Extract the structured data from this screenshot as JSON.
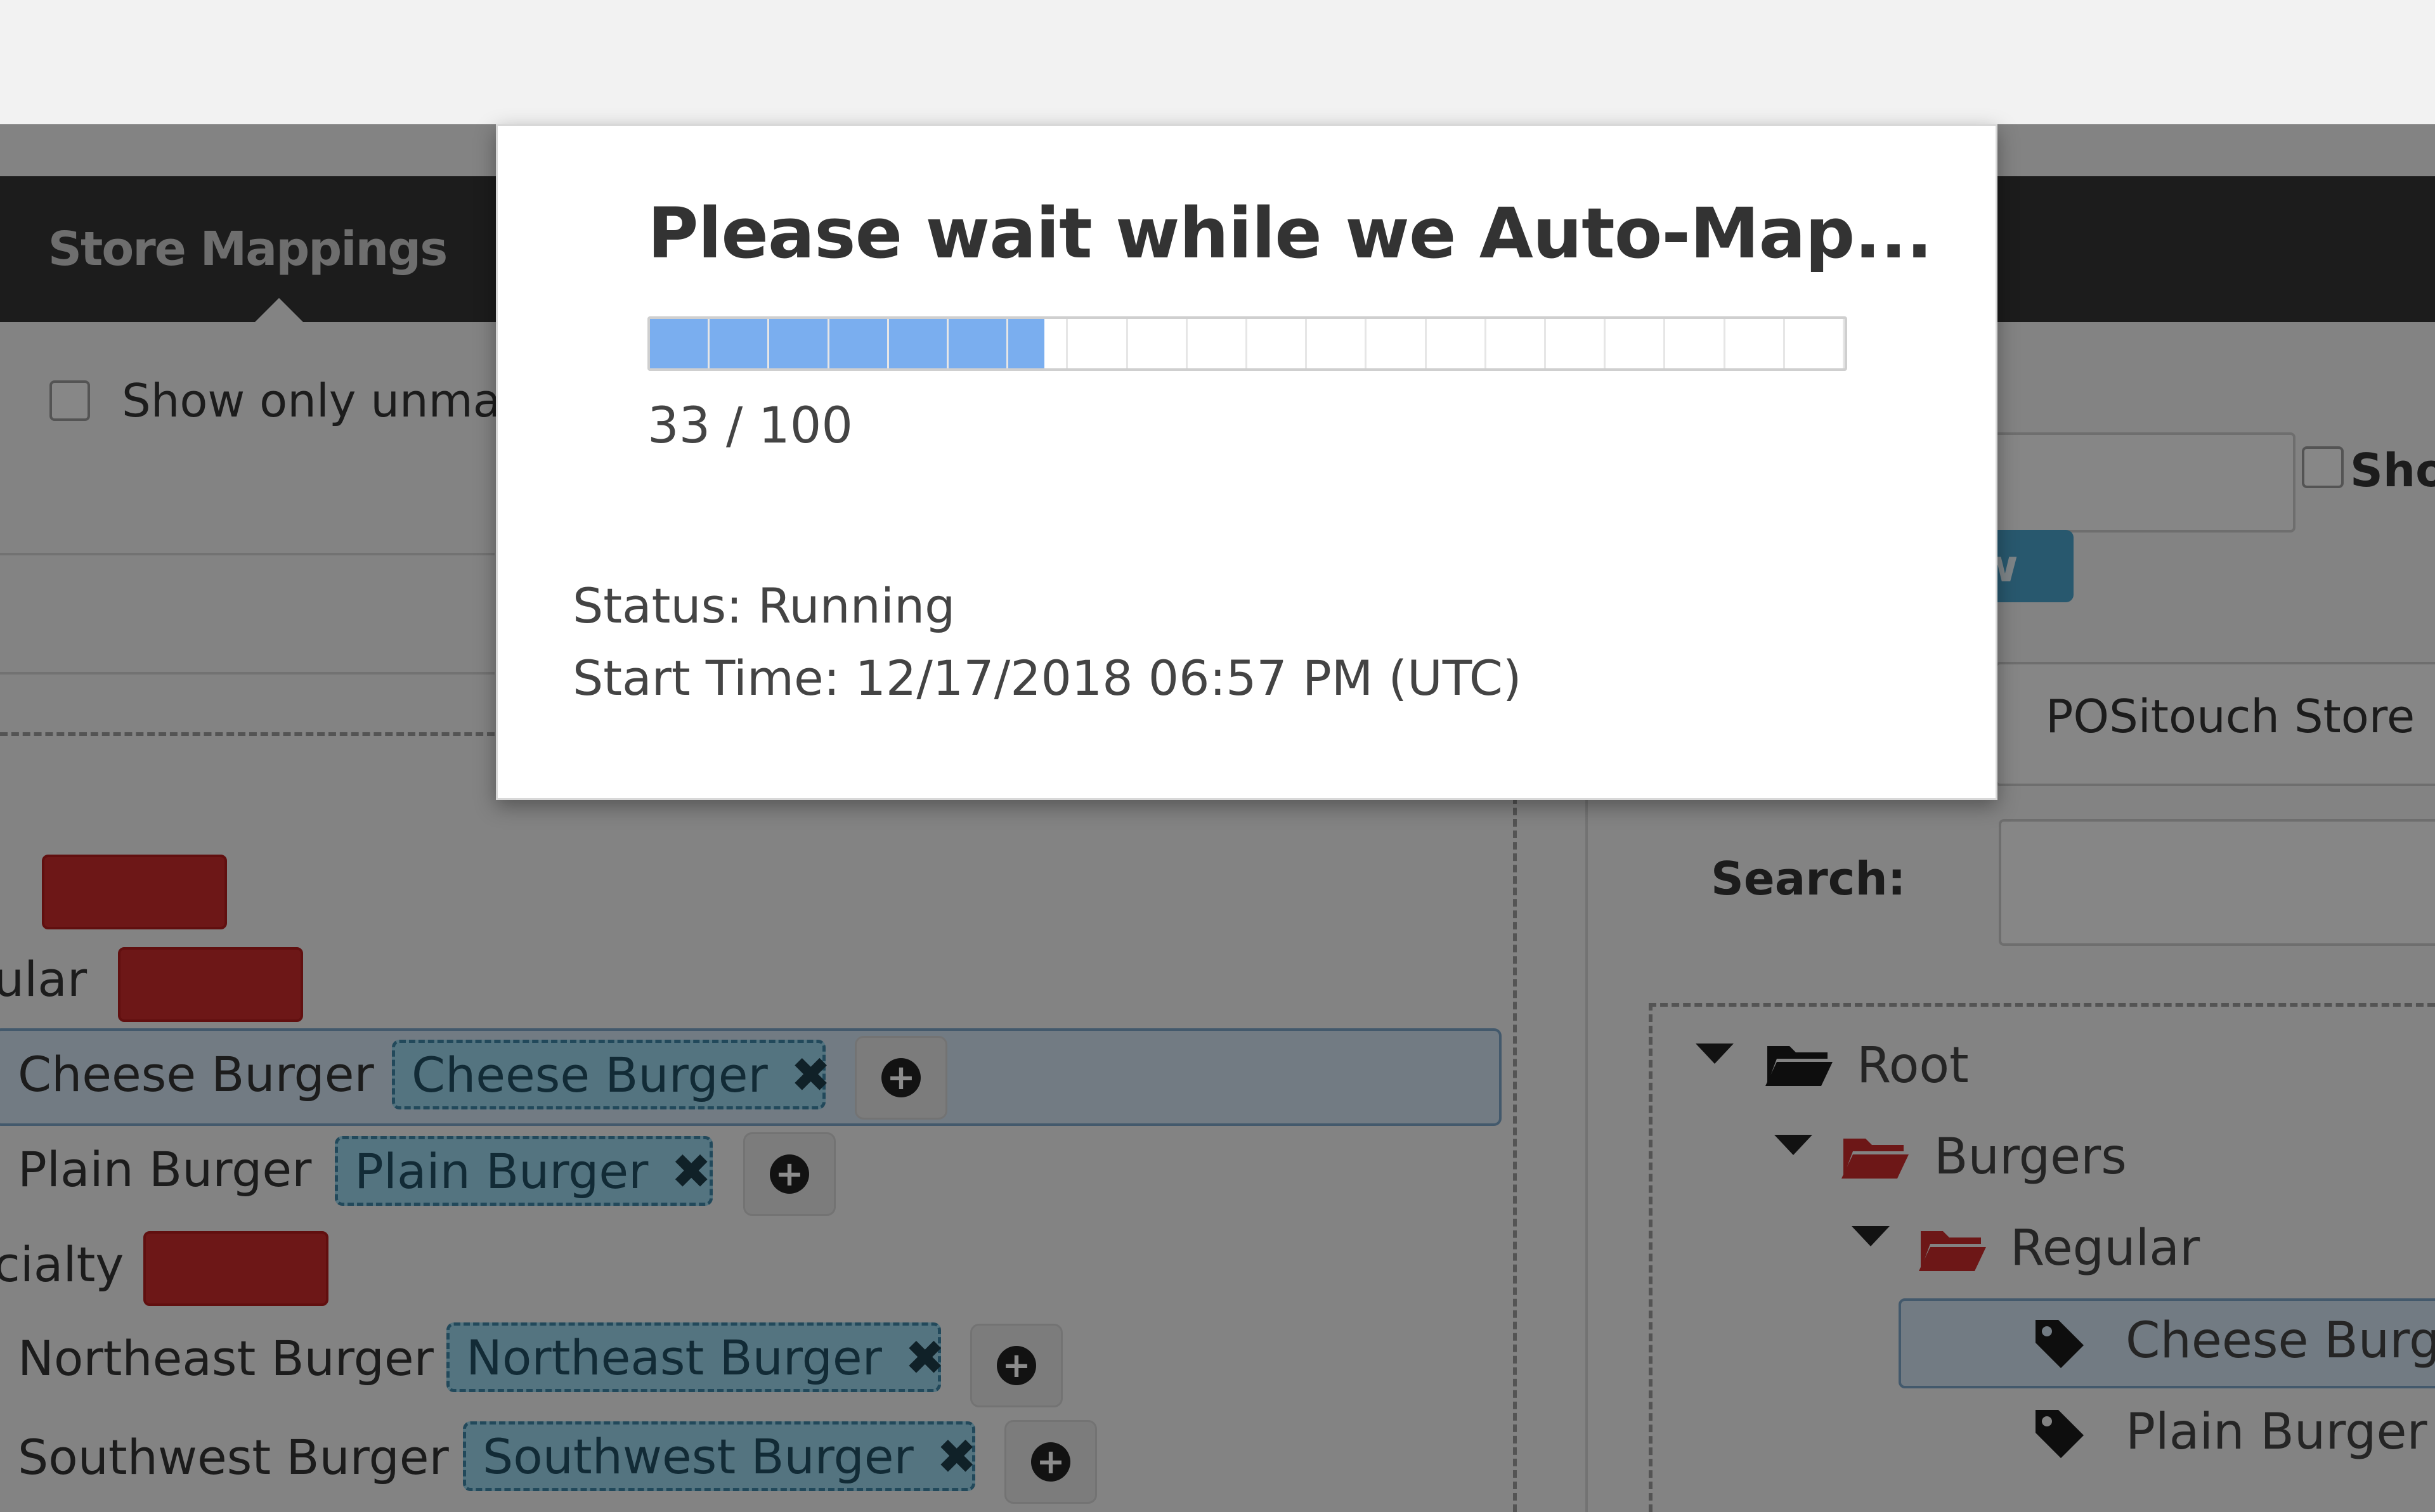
{
  "nav": {
    "active_tab": "Store Mappings"
  },
  "left": {
    "filter_label": "Show only unma",
    "rows": [
      {
        "label": "",
        "tag": null,
        "empty": true
      },
      {
        "label": "ular",
        "tag": null,
        "empty": true
      },
      {
        "label": "Cheese Burger",
        "tag": "Cheese Burger",
        "highlighted": true
      },
      {
        "label": "Plain Burger",
        "tag": "Plain Burger"
      },
      {
        "label": "cialty",
        "tag": null,
        "empty": true
      },
      {
        "label": "Northeast Burger",
        "tag": "Northeast Burger"
      },
      {
        "label": "Southwest Burger",
        "tag": "Southwest Burger"
      }
    ],
    "remove_glyph": "✖",
    "add_glyph": "+"
  },
  "right": {
    "show_label": "Sho",
    "button_label": "w",
    "store_label": "POSitouch Store",
    "search_label": "Search:",
    "tree": [
      {
        "label": "Root",
        "icon": "folder-open-icon"
      },
      {
        "label": "Burgers",
        "icon": "folder-open-red-icon"
      },
      {
        "label": "Regular",
        "icon": "folder-open-red-icon"
      },
      {
        "label": "Cheese Burge",
        "icon": "tag-icon",
        "selected": true
      },
      {
        "label": "Plain Burger",
        "icon": "tag-icon"
      }
    ]
  },
  "modal": {
    "title": "Please wait while we Auto-Map...",
    "progress": {
      "current": 33,
      "total": 100,
      "text": "33 / 100"
    },
    "status": "Status: Running",
    "start_time": "Start Time: 12/17/2018 06:57 PM (UTC)"
  },
  "colors": {
    "accent": "#7aaeef",
    "danger": "#c62b2b",
    "tag": "#9ad4ea"
  }
}
